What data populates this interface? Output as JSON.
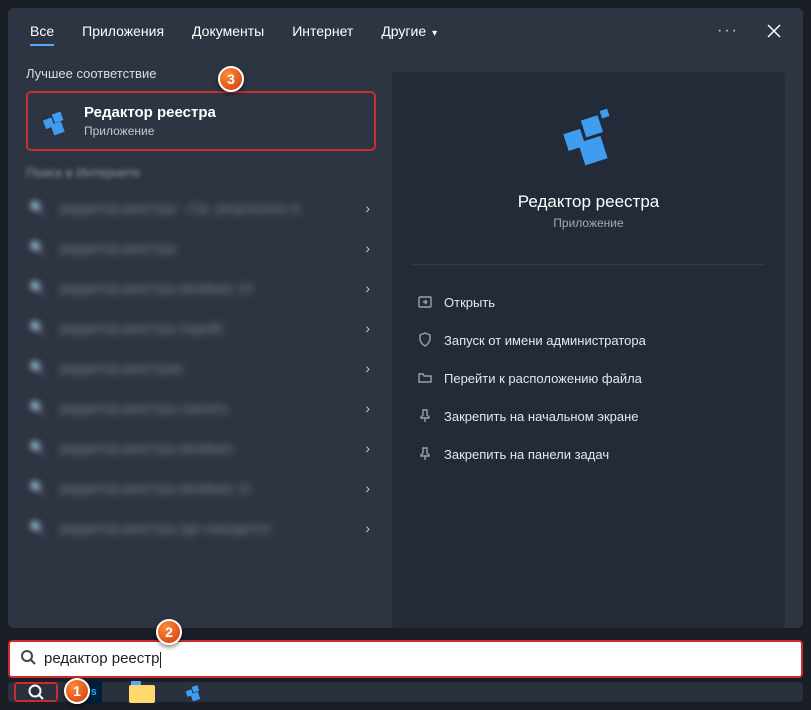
{
  "tabs": {
    "all": "Все",
    "apps": "Приложения",
    "docs": "Документы",
    "net": "Интернет",
    "more": "Другие"
  },
  "left": {
    "bestHeader": "Лучшее соответствие",
    "best": {
      "title": "Редактор реестра",
      "subtitle": "Приложение"
    },
    "webHeader": "Поиск в Интернете",
    "webRows": [
      "редактор реестра - См. результаты в",
      "редактор реестра",
      "редактор реестра windows 10",
      "редактор реестра regedit",
      "редактор реестров",
      "редактор реестра скачать",
      "редактор реестра windows",
      "редактор реестра windows 11",
      "редактор реестра где находится"
    ],
    "arrow": "›"
  },
  "preview": {
    "title": "Редактор реестра",
    "subtitle": "Приложение",
    "actions": {
      "open": "Открыть",
      "admin": "Запуск от имени администратора",
      "location": "Перейти к расположению файла",
      "pinStart": "Закрепить на начальном экране",
      "pinTaskbar": "Закрепить на панели задач"
    }
  },
  "search": {
    "value": "редактор реестр"
  },
  "badges": {
    "b1": "1",
    "b2": "2",
    "b3": "3"
  },
  "more": "···"
}
